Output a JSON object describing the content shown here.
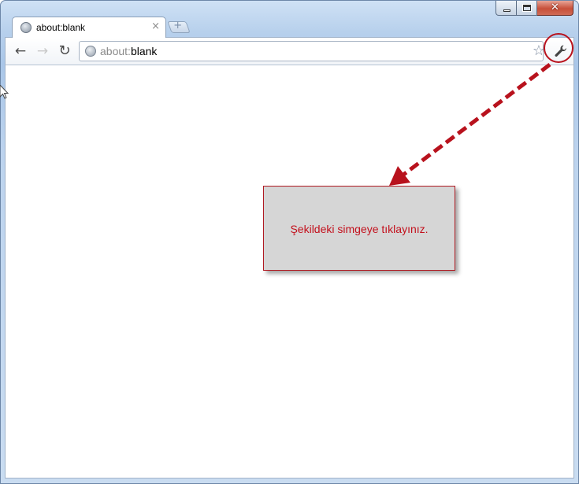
{
  "window": {
    "close_glyph": "✕"
  },
  "tab": {
    "title": "about:blank",
    "close_glyph": "×",
    "favicon": "globe-icon"
  },
  "new_tab": {
    "glyph": "+"
  },
  "toolbar": {
    "back_glyph": "←",
    "forward_glyph": "→",
    "reload_glyph": "↻",
    "star_glyph": "☆",
    "wrench_glyph": "🔧"
  },
  "omnibox": {
    "scheme": "about:",
    "host": "blank"
  },
  "callout": {
    "text": "Şekildeki simgeye tıklayınız."
  },
  "colors": {
    "annotation_red": "#b8121d",
    "callout_background": "#d6d6d6"
  }
}
